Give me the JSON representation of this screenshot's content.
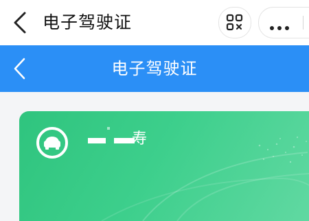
{
  "top_bar": {
    "title": "电子驾驶证",
    "scan_icon": "scan-icon",
    "more_icon": "more-icon"
  },
  "nav_bar": {
    "title": "电子驾驶证"
  },
  "card": {
    "name_visible": "寿",
    "icon": "car-icon"
  },
  "colors": {
    "nav_blue": "#2b8ff6",
    "card_green": "#37c985"
  }
}
